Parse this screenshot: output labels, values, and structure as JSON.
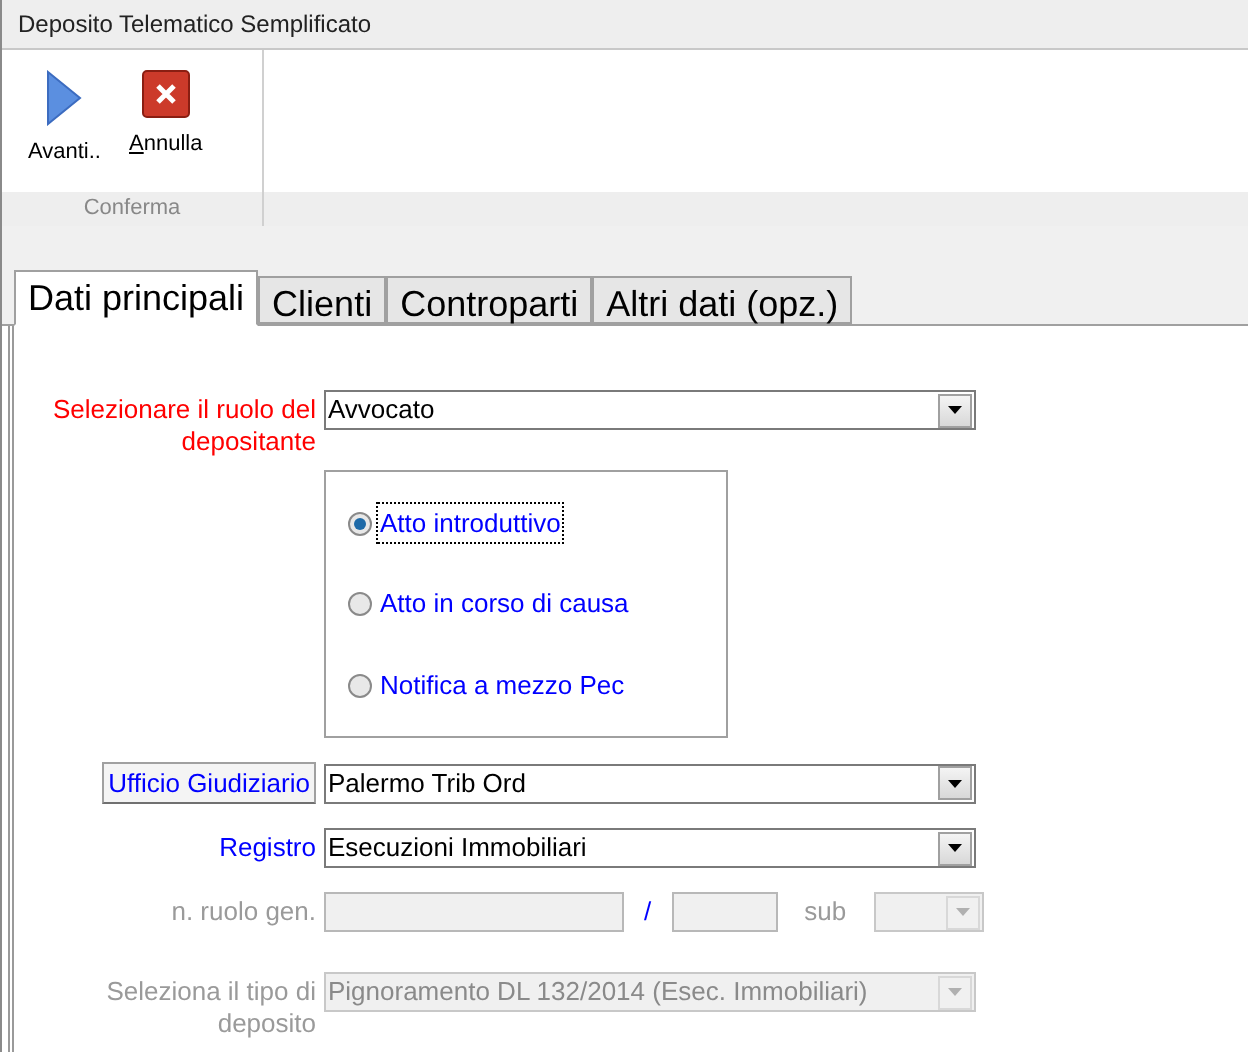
{
  "window": {
    "title": "Deposito Telematico Semplificato"
  },
  "ribbon": {
    "buttons": [
      {
        "kind": "next",
        "label": "Avanti.."
      },
      {
        "kind": "cancel",
        "label": "Annulla"
      }
    ],
    "group": "Conferma"
  },
  "tabs": [
    {
      "label": "Dati principali",
      "selected": true
    },
    {
      "label": "Clienti",
      "selected": false
    },
    {
      "label": "Controparti",
      "selected": false
    },
    {
      "label": "Altri dati (opz.)",
      "selected": false
    }
  ],
  "role": {
    "label": "Selezionare il ruolo del depositante",
    "required": true,
    "value": "Avvocato"
  },
  "options": [
    {
      "label": "Atto introduttivo",
      "selected": true
    },
    {
      "label": "Atto in corso di causa",
      "selected": false
    },
    {
      "label": "Notifica a mezzo Pec",
      "selected": false
    }
  ],
  "office": {
    "button": "Ufficio Giudiziario",
    "value": "Palermo Trib Ord"
  },
  "register": {
    "label": "Registro",
    "value": "Esecuzioni Immobiliari",
    "disabled": false
  },
  "case_number": {
    "label": "n. ruolo gen.",
    "separator": "/",
    "sub_label": "sub",
    "disabled": true
  },
  "filing_type": {
    "label": "Seleziona il tipo di deposito",
    "value": "Pignoramento DL 132/2014 (Esec. Immobiliari)",
    "disabled": true
  }
}
